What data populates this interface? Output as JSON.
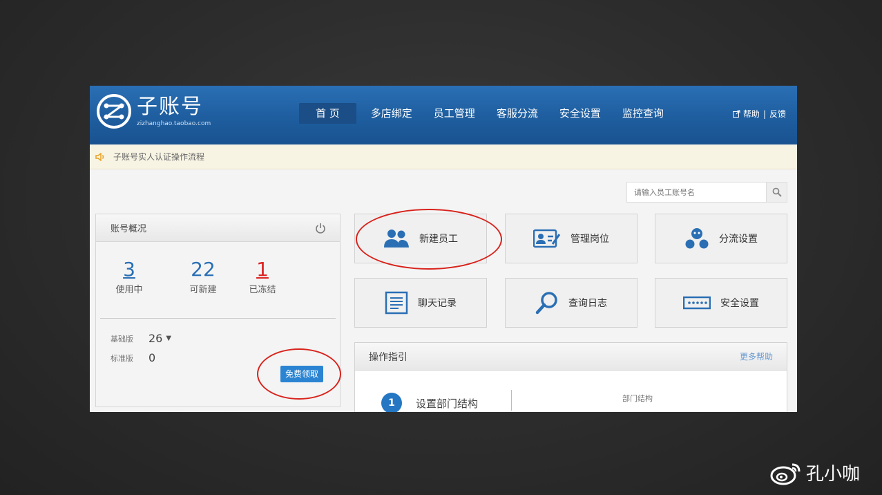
{
  "header": {
    "logo_title": "子账号",
    "logo_url": "zizhanghao.taobao.com",
    "nav": [
      "首 页",
      "多店绑定",
      "员工管理",
      "客服分流",
      "安全设置",
      "监控查询"
    ],
    "help": "帮助",
    "feedback": "反馈"
  },
  "notice": {
    "text": "子账号实人认证操作流程"
  },
  "search": {
    "placeholder": "请输入员工账号名"
  },
  "account": {
    "title": "账号概况",
    "stats": [
      {
        "value": "3",
        "label": "使用中"
      },
      {
        "value": "22",
        "label": "可新建"
      },
      {
        "value": "1",
        "label": "已冻结"
      }
    ],
    "editions": [
      {
        "label": "基础版",
        "value": "26"
      },
      {
        "label": "标准版",
        "value": "0"
      }
    ],
    "free_button": "免费领取"
  },
  "tiles": [
    "新建员工",
    "管理岗位",
    "分流设置",
    "聊天记录",
    "查询日志",
    "安全设置"
  ],
  "guide": {
    "title": "操作指引",
    "more": "更多帮助",
    "step_num": "1",
    "step_label": "设置部门结构",
    "dept": "部门结构"
  },
  "watermark": "孔小咖",
  "colors": {
    "header": "#1d5c9d",
    "accent": "#2577c3",
    "annotation": "#d8231c"
  }
}
